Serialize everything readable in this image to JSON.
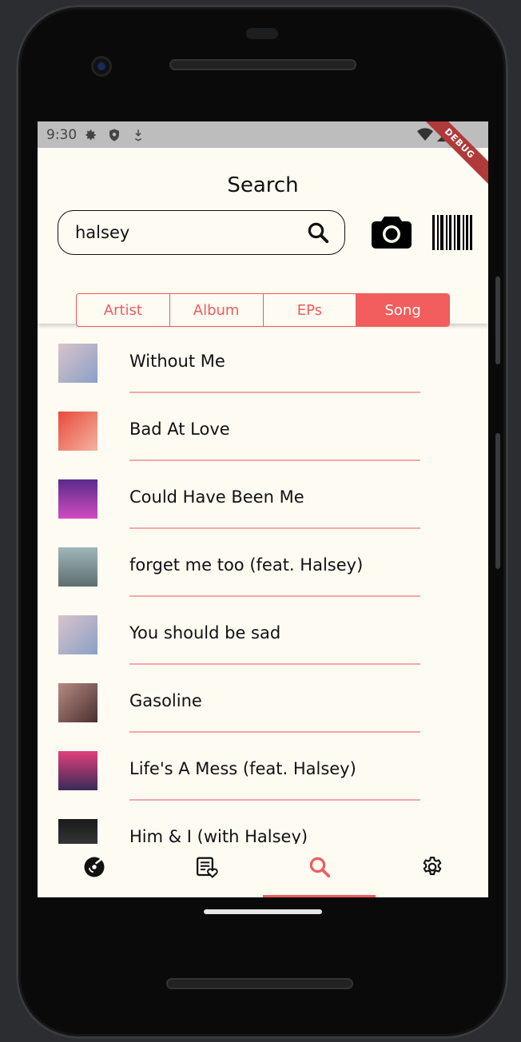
{
  "status_bar": {
    "time": "9:30",
    "debug_label": "DEBUG"
  },
  "header": {
    "title": "Search",
    "search": {
      "value": "halsey",
      "placeholder": ""
    }
  },
  "segments": {
    "items": [
      {
        "label": "Artist",
        "selected": false
      },
      {
        "label": "Album",
        "selected": false
      },
      {
        "label": "EPs",
        "selected": false
      },
      {
        "label": "Song",
        "selected": true
      }
    ]
  },
  "results": [
    {
      "title": "Without Me",
      "art_color": "#c9a7b8"
    },
    {
      "title": "Bad At Love",
      "art_color": "#e84a3c"
    },
    {
      "title": "Could Have Been Me",
      "art_color": "#7b3aa8"
    },
    {
      "title": "forget me too (feat. Halsey)",
      "art_color": "#8aa3a6"
    },
    {
      "title": "You should be sad",
      "art_color": "#c9a7b8"
    },
    {
      "title": "Gasoline",
      "art_color": "#7a4f4a"
    },
    {
      "title": "Life's A Mess (feat. Halsey)",
      "art_color": "#b8324a"
    },
    {
      "title": "Him & I (with Halsey)",
      "art_color": "#2a2a2a"
    }
  ],
  "bottom_nav": {
    "items": [
      {
        "icon": "album-disc-icon",
        "active": false
      },
      {
        "icon": "playlist-heart-icon",
        "active": false
      },
      {
        "icon": "search-icon",
        "active": true
      },
      {
        "icon": "settings-gear-icon",
        "active": false
      }
    ]
  },
  "colors": {
    "accent": "#f25d5d",
    "background": "#fefbf3",
    "divider": "#f3a8a8"
  }
}
